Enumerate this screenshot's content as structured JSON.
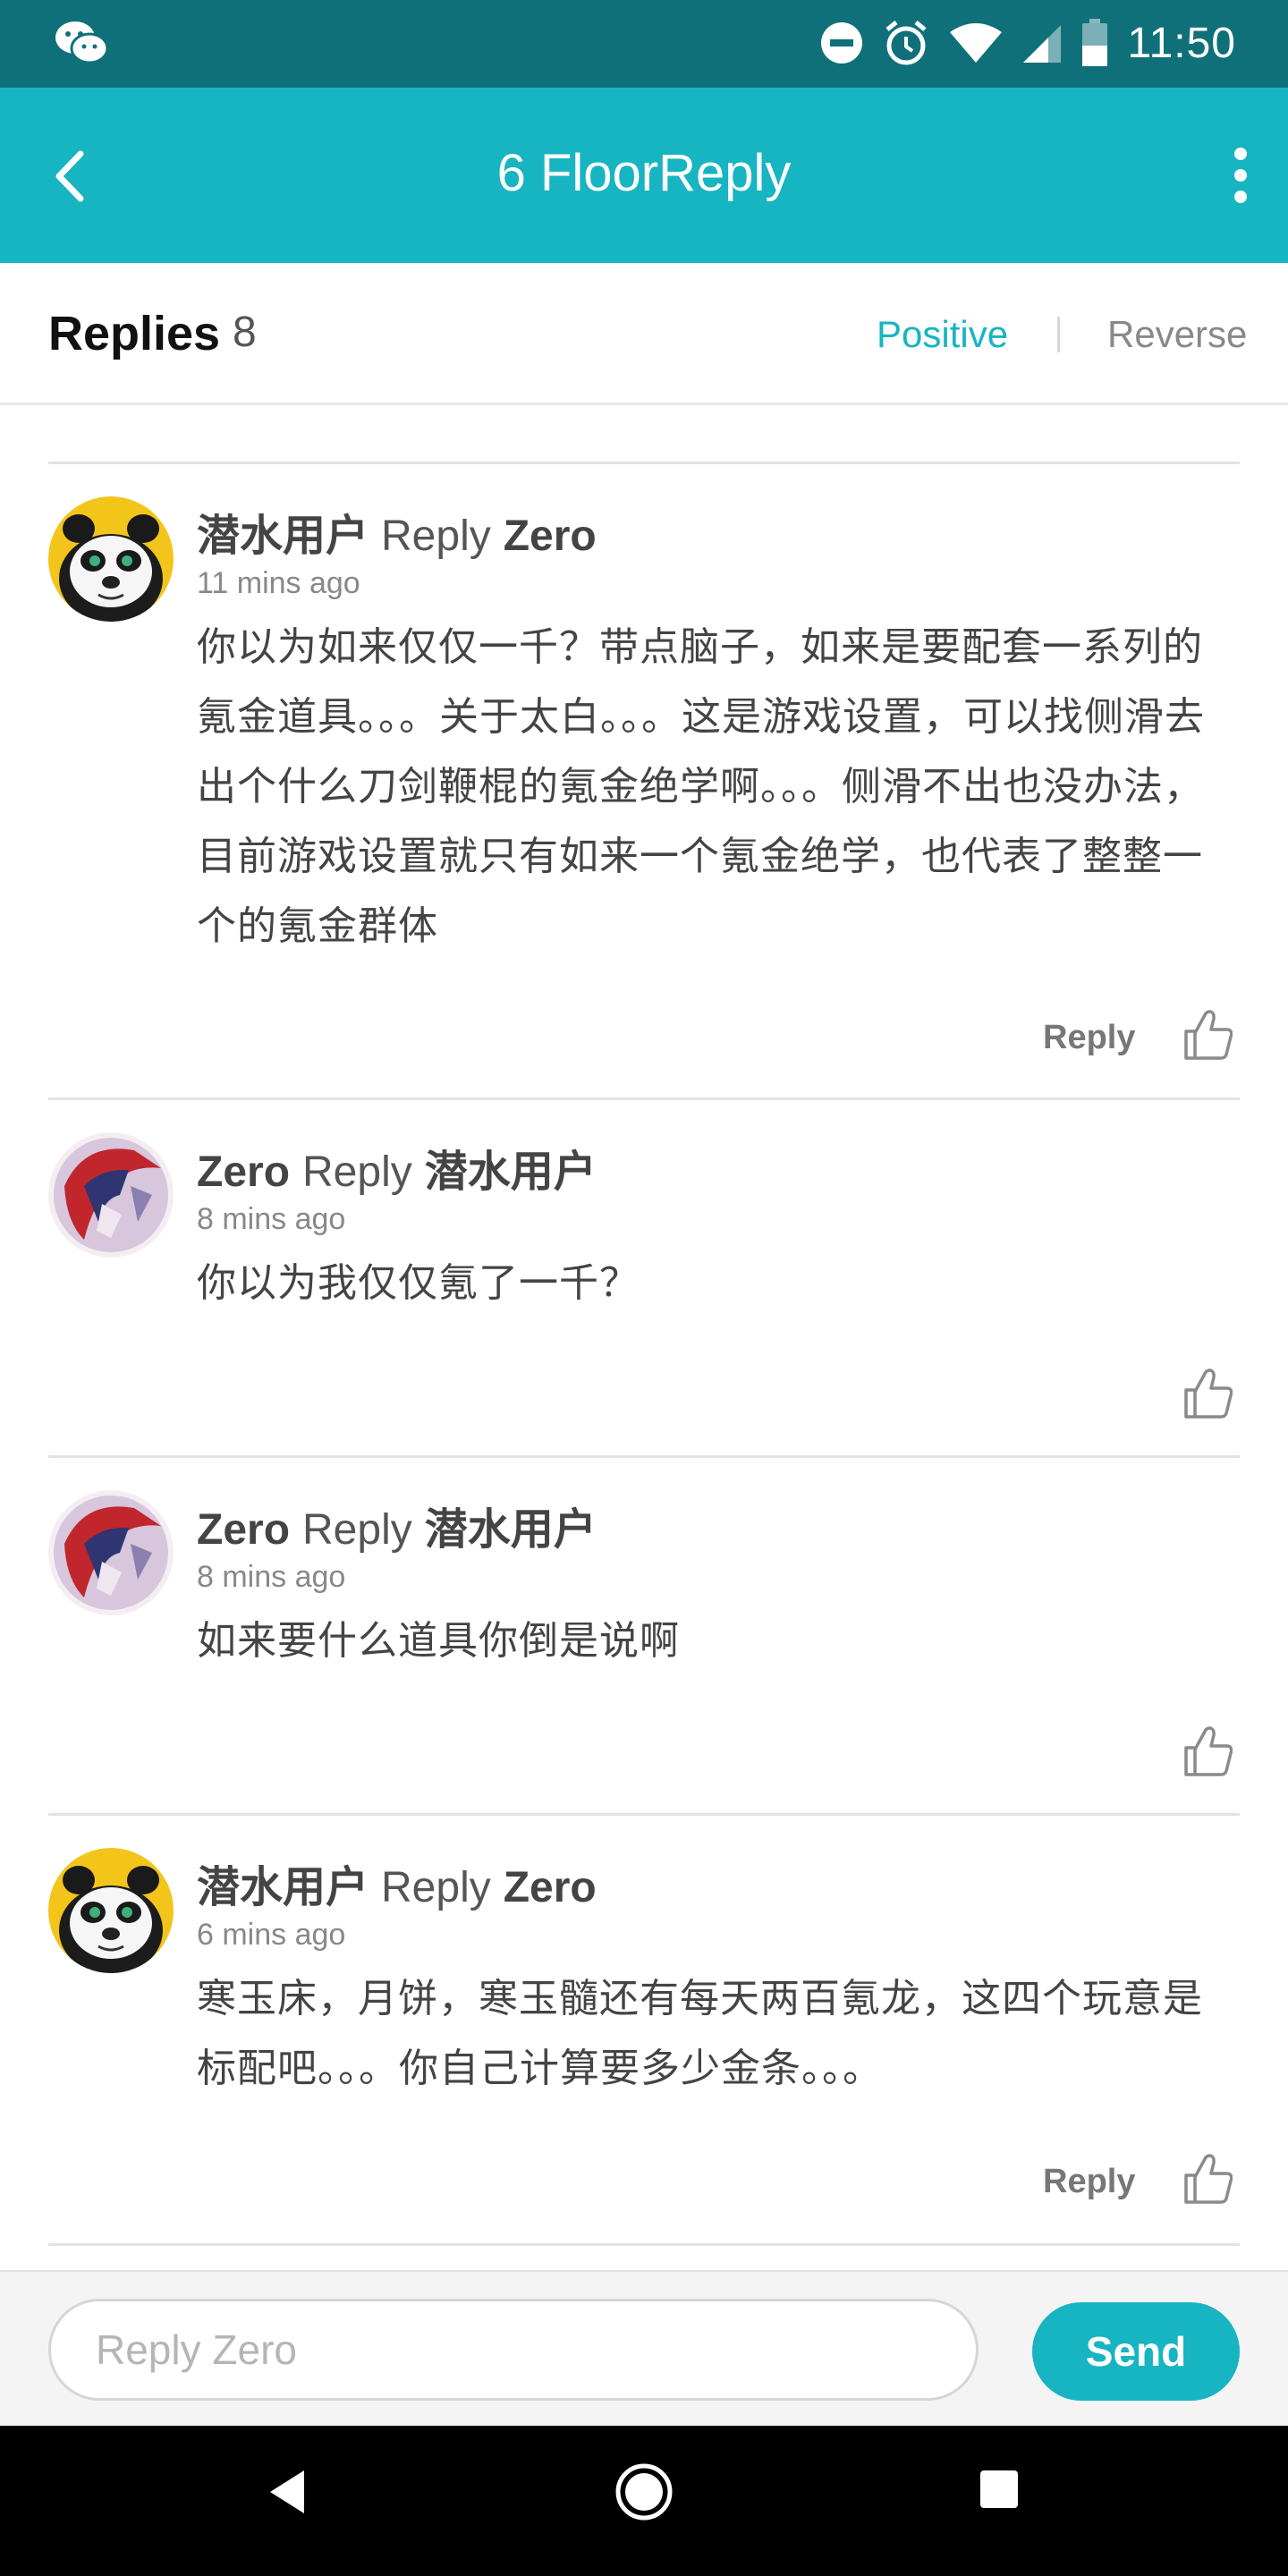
{
  "status_bar": {
    "time": "11:50",
    "icons": [
      "wechat-icon",
      "do-not-disturb-icon",
      "alarm-icon",
      "wifi-icon",
      "signal-icon",
      "battery-icon"
    ]
  },
  "app_bar": {
    "title": "6 FloorReply",
    "icons": [
      "back-arrow-icon",
      "more-vert-icon"
    ]
  },
  "replies_header": {
    "label": "Replies",
    "count": "8",
    "sort_positive": "Positive",
    "sort_reverse": "Reverse",
    "active_color": "#17b4c2"
  },
  "comments": [
    {
      "author": "潜水用户",
      "reply_word": "Reply",
      "target": "Zero",
      "time": "11 mins ago",
      "text": "你以为如来仅仅一千？带点脑子，如来是要配套一系列的氪金道具。。。关于太白。。。这是游戏设置，可以找侧滑去出个什么刀剑鞭棍的氪金绝学啊。。。侧滑不出也没办法，目前游戏设置就只有如来一个氪金绝学，也代表了整整一个的氪金群体",
      "reply_button": "Reply",
      "avatar": "panda"
    },
    {
      "author": "Zero",
      "reply_word": "Reply",
      "target": "潜水用户",
      "time": "8 mins ago",
      "text": "你以为我仅仅氪了一千？",
      "reply_button": "",
      "avatar": "red-hero"
    },
    {
      "author": "Zero",
      "reply_word": "Reply",
      "target": "潜水用户",
      "time": "8 mins ago",
      "text": "如来要什么道具你倒是说啊",
      "reply_button": "",
      "avatar": "red-hero"
    },
    {
      "author": "潜水用户",
      "reply_word": "Reply",
      "target": "Zero",
      "time": "6 mins ago",
      "text": "寒玉床，月饼，寒玉髓还有每天两百氪龙，这四个玩意是标配吧。。。你自己计算要多少金条。。。",
      "reply_button": "Reply",
      "avatar": "panda"
    }
  ],
  "composer": {
    "placeholder": "Reply Zero",
    "send_label": "Send"
  },
  "nav_bar": {
    "icons": [
      "nav-back-icon",
      "nav-home-icon",
      "nav-recents-icon"
    ]
  }
}
